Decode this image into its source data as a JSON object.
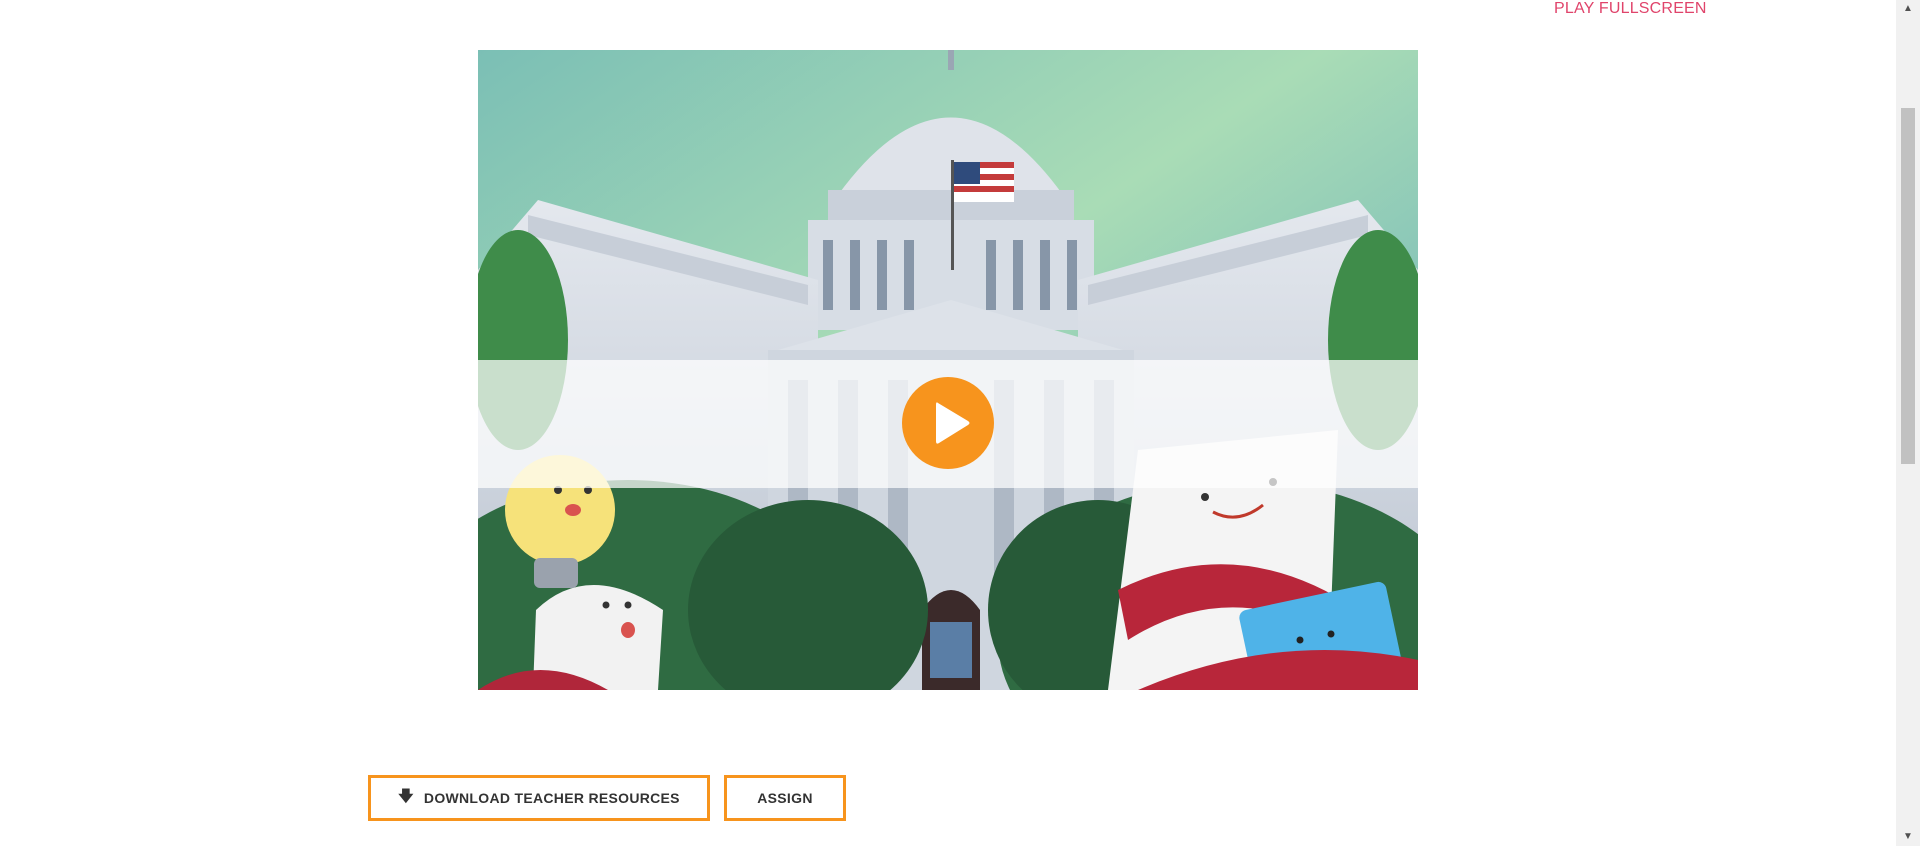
{
  "header": {
    "fullscreen_label": "PLAY FULLSCREEN"
  },
  "video": {
    "play_icon": "play-icon"
  },
  "actions": {
    "download_icon": "download-arrow-icon",
    "download_label": "DOWNLOAD TEACHER RESOURCES",
    "assign_label": "ASSIGN"
  },
  "colors": {
    "accent": "#f7941d",
    "link": "#e0446b"
  }
}
